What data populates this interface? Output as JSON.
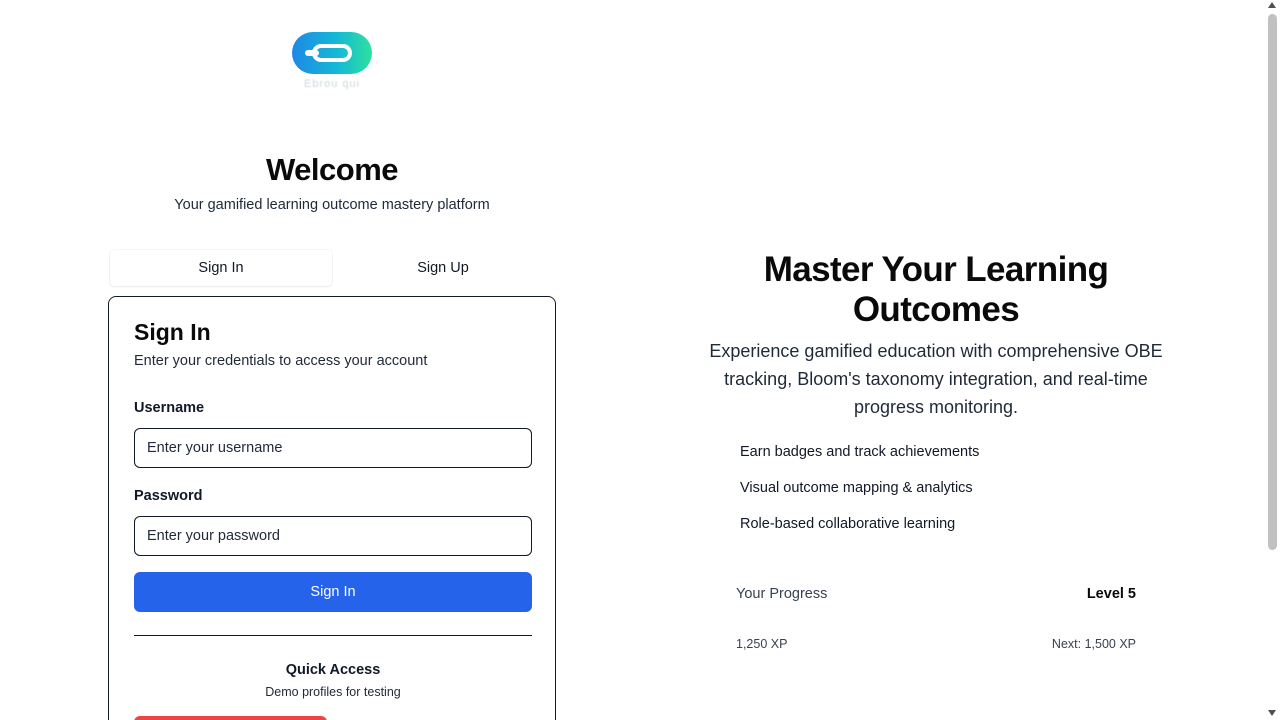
{
  "brand": {
    "logo_text": "Ebrou qui",
    "gradient_start": "#1e88e5",
    "gradient_end": "#2ee0a0"
  },
  "welcome": {
    "title": "Welcome",
    "subtitle": "Your gamified learning outcome mastery platform"
  },
  "tabs": [
    {
      "label": "Sign In",
      "active": true
    },
    {
      "label": "Sign Up",
      "active": false
    }
  ],
  "signin_card": {
    "title": "Sign In",
    "description": "Enter your credentials to access your account",
    "username_label": "Username",
    "username_placeholder": "Enter your username",
    "username_value": "",
    "password_label": "Password",
    "password_placeholder": "Enter your password",
    "password_value": "",
    "submit_label": "Sign In",
    "submit_color": "#2563eb",
    "quick_access_title": "Quick Access",
    "quick_access_subtitle": "Demo profiles for testing",
    "demo_button_color": "#ef4444"
  },
  "hero": {
    "title": "Master Your Learning Outcomes",
    "subtitle": "Experience gamified education with comprehensive OBE tracking, Bloom's taxonomy integration, and real-time progress monitoring.",
    "features": [
      "Earn badges and track achievements",
      "Visual outcome mapping & analytics",
      "Role-based collaborative learning"
    ]
  },
  "progress": {
    "label": "Your Progress",
    "level": "Level 5",
    "xp": "1,250 XP",
    "next": "Next: 1,500 XP"
  }
}
